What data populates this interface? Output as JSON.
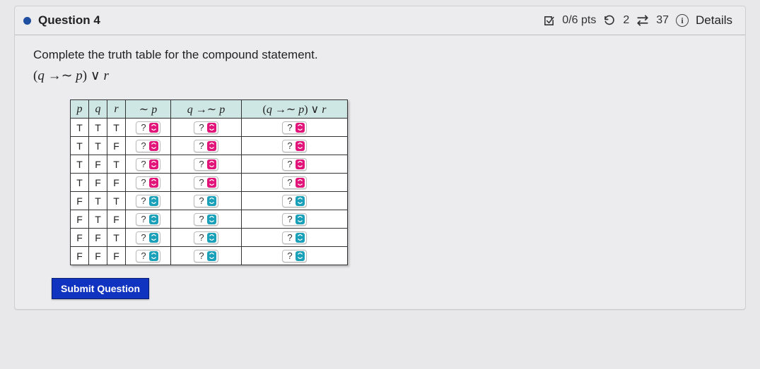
{
  "header": {
    "question_label": "Question 4",
    "score": "0/6 pts",
    "attempts_remaining": "2",
    "time_or_tries": "37",
    "details_label": "Details"
  },
  "body": {
    "instruction": "Complete the truth table for the compound statement.",
    "formula": "(q → ∼ p) ∨ r"
  },
  "table": {
    "headers": {
      "p": "p",
      "q": "q",
      "r": "r",
      "notp": "∼ p",
      "impl": "q → ∼ p",
      "full": "(q → ∼ p) ∨ r"
    },
    "rows": [
      {
        "p": "T",
        "q": "T",
        "r": "T"
      },
      {
        "p": "T",
        "q": "T",
        "r": "F"
      },
      {
        "p": "T",
        "q": "F",
        "r": "T"
      },
      {
        "p": "T",
        "q": "F",
        "r": "F"
      },
      {
        "p": "F",
        "q": "T",
        "r": "T"
      },
      {
        "p": "F",
        "q": "T",
        "r": "F"
      },
      {
        "p": "F",
        "q": "F",
        "r": "T"
      },
      {
        "p": "F",
        "q": "F",
        "r": "F"
      }
    ],
    "select_placeholder": "?"
  },
  "actions": {
    "submit_label": "Submit Question"
  }
}
